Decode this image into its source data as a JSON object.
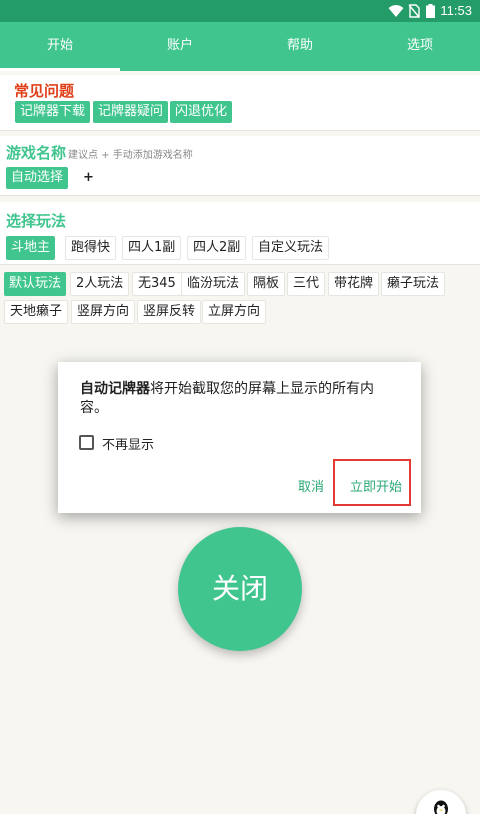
{
  "status": {
    "time": "11:53",
    "icons": [
      "wifi-icon",
      "no-sim-icon",
      "battery-icon"
    ]
  },
  "tabs": [
    {
      "label": "开始",
      "active": true
    },
    {
      "label": "账户"
    },
    {
      "label": "帮助"
    },
    {
      "label": "选项"
    }
  ],
  "faq": {
    "title": "常见问题",
    "links": [
      "记牌器下载",
      "记牌器疑问",
      "闪退优化"
    ]
  },
  "game": {
    "title": "游戏名称",
    "hint": "建议点 + 手动添加游戏名称",
    "selected": "自动选择",
    "add": "+"
  },
  "mode": {
    "title": "选择玩法",
    "options": [
      "斗地主",
      "跑得快",
      "四人1副",
      "四人2副",
      "自定义玩法"
    ]
  },
  "rules": {
    "row1": [
      "默认玩法",
      "2人玩法",
      "无345",
      "临汾玩法",
      "隔板",
      "三代",
      "带花牌",
      "癞子玩法"
    ],
    "row2": [
      "天地癞子",
      "竖屏方向",
      "竖屏反转",
      "立屏方向"
    ]
  },
  "dialog": {
    "app_name": "自动记牌器",
    "message": "将开始截取您的屏幕上显示的所有内容。",
    "checkbox_label": "不再显示",
    "cancel": "取消",
    "confirm": "立即开始",
    "highlight_color": "#e53935"
  },
  "close_button": "关闭",
  "colors": {
    "accent": "#40c58e",
    "status_bar": "#239c69",
    "faq_title": "#e0401a"
  }
}
